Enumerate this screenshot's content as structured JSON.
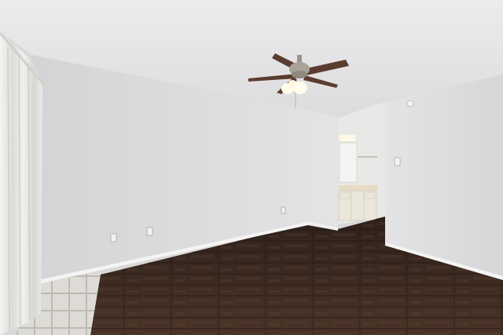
{
  "scene": {
    "colors": {
      "ceiling": "#e6e6e8",
      "wall_left": "#dcdcde",
      "wall_right": "#e0e0e2",
      "floor": "#3d2b22",
      "tile": "#dcdad5",
      "baseboard": "#f2f2f2",
      "curtain": "#ececea",
      "fan_blade": "#5a3d2e",
      "fan_metal": "#9a958c",
      "vanity": "#e8e2d4"
    },
    "icons": [
      "ceiling-fan-icon",
      "light-switch-icon",
      "outlet-icon"
    ]
  }
}
